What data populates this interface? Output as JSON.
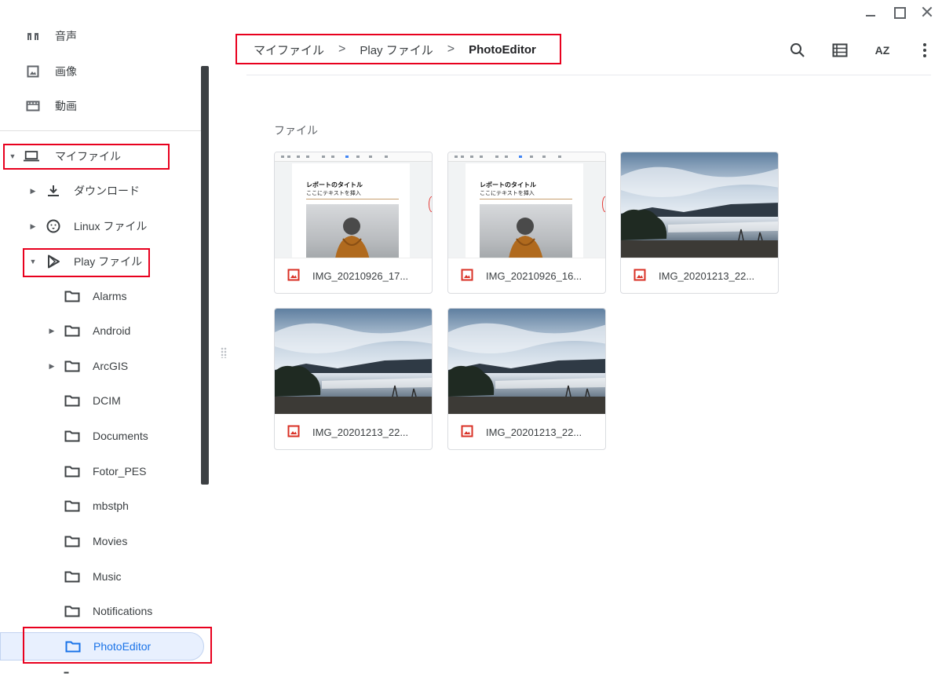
{
  "window": {
    "controls": [
      "minimize",
      "maximize",
      "close"
    ]
  },
  "sidebar": {
    "top_items": [
      {
        "icon": "audio-icon",
        "label": "音声"
      },
      {
        "icon": "image-icon",
        "label": "画像"
      },
      {
        "icon": "video-icon",
        "label": "動画"
      }
    ],
    "my_files": {
      "label": "マイファイル",
      "expanded": true
    },
    "downloads": {
      "label": "ダウンロード"
    },
    "linux": {
      "label": "Linux ファイル"
    },
    "play": {
      "label": "Play ファイル",
      "expanded": true
    },
    "folders": [
      {
        "label": "Alarms",
        "has_children": false
      },
      {
        "label": "Android",
        "has_children": true
      },
      {
        "label": "ArcGIS",
        "has_children": true
      },
      {
        "label": "DCIM",
        "has_children": false
      },
      {
        "label": "Documents",
        "has_children": false
      },
      {
        "label": "Fotor_PES",
        "has_children": false
      },
      {
        "label": "mbstph",
        "has_children": false
      },
      {
        "label": "Movies",
        "has_children": false
      },
      {
        "label": "Music",
        "has_children": false
      },
      {
        "label": "Notifications",
        "has_children": false
      },
      {
        "label": "PhotoEditor",
        "has_children": false,
        "selected": true
      }
    ]
  },
  "breadcrumb": {
    "items": [
      "マイファイル",
      "Play ファイル",
      "PhotoEditor"
    ],
    "separator": ">"
  },
  "toolbar": {
    "buttons": [
      "search-icon",
      "list-view-icon",
      "sort-az-icon",
      "more-vert-icon"
    ],
    "sort_label": "AZ"
  },
  "main": {
    "section_title": "ファイル",
    "files": [
      {
        "name": "IMG_20210926_17...",
        "thumb": "document",
        "doc_title": "レポートのタイトル",
        "doc_subtitle": "ここにテキストを挿入"
      },
      {
        "name": "IMG_20210926_16...",
        "thumb": "document",
        "doc_title": "レポートのタイトル",
        "doc_subtitle": "ここにテキストを挿入"
      },
      {
        "name": "IMG_20201213_22...",
        "thumb": "landscape"
      },
      {
        "name": "IMG_20201213_22...",
        "thumb": "landscape"
      },
      {
        "name": "IMG_20201213_22...",
        "thumb": "landscape"
      }
    ]
  },
  "colors": {
    "accent": "#1a73e8",
    "highlight_box": "#e8001e",
    "selected_bg": "#e8f0fe",
    "file_icon": "#d93025"
  }
}
